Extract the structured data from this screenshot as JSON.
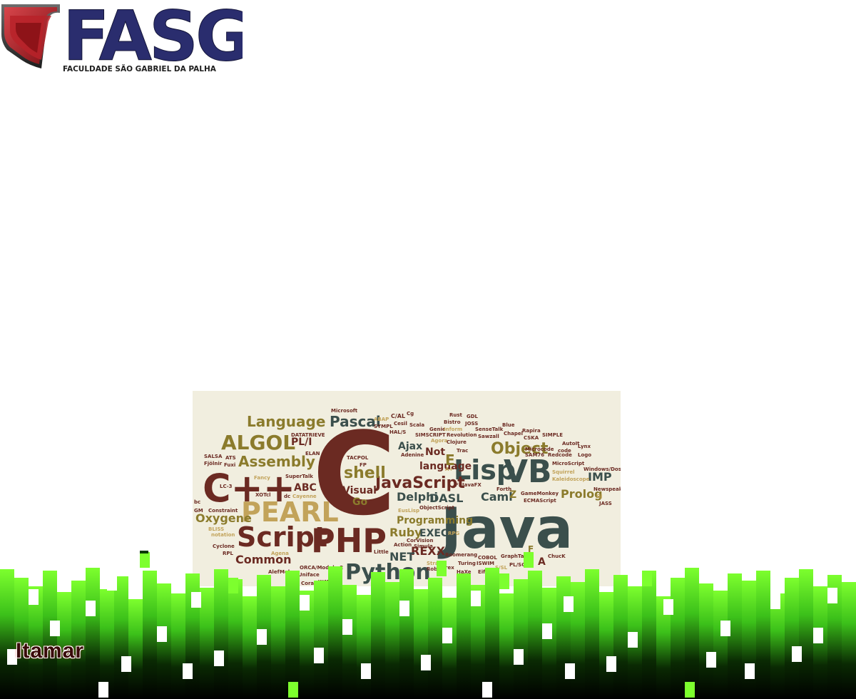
{
  "logo": {
    "name": "FASG",
    "subtitle": "FACULDADE SÃO GABRIEL DA PALHA",
    "colors": {
      "primary": "#2a2d6e",
      "accent": "#b3202a"
    }
  },
  "word_cloud": {
    "colors": [
      "#3b4f4c",
      "#6b2a22",
      "#8b7b2c",
      "#c2a35a"
    ],
    "words": [
      "Java",
      "C",
      "C++",
      "PHP",
      "Script",
      "PEARL",
      "Python",
      "ALGOL",
      "Lisp",
      "VB",
      "Language",
      "Pascal",
      "Assembly",
      "JavaScript",
      "Object",
      "shell",
      "Ruby",
      "Delphi",
      "Prolog",
      "Caml",
      "IMP",
      "Oxygene",
      "Common",
      "REXX",
      "EXEC",
      "NET",
      "Programming",
      "DASL",
      "Visual",
      "Go",
      "ABC",
      "PL/I",
      "Ajax",
      "language",
      "Not",
      "E",
      "Z",
      "A",
      "F",
      "Microsoft",
      "ABAP",
      "C/AL",
      "Cg",
      "Rust",
      "GDL",
      "Cesil",
      "Scala",
      "Bistro",
      "JOSS",
      "Blue",
      "SYMPL",
      "HAL/S",
      "Genie",
      "Inform",
      "SenseTalk",
      "Rapira",
      "DATATRIEVE",
      "SIMSCRIPT",
      "Revolution",
      "Sawzall",
      "Chapel",
      "CSKA",
      "SIMPLE",
      "ELAN",
      "Agora",
      "Clojure",
      "Microcode",
      "AutoIt",
      "Lynx",
      "Adenine",
      "Trac",
      "code",
      "SAM76",
      "Redcode",
      "Logo",
      "TACPOL",
      "SALSA",
      "ATS",
      "Fjölnir",
      "Fuxi",
      "FP",
      "A+",
      "MicroScript",
      "Windows/Dos",
      "SuperTalk",
      "Fancy",
      "Squirrel",
      "Kaleidoscope",
      "LC-3",
      "FL",
      "JavaFX",
      "Forth",
      "GameMonkey",
      "Newspeak",
      "XOTcl",
      "Cayenne",
      "ECMAScript",
      "GJ",
      "JASS",
      "bc",
      "GM",
      "Constraint",
      "ObjectScript",
      "EusLisp",
      "BLISS",
      "notation",
      "RPG",
      "Cyclone",
      "Action",
      "CorVision",
      "RPL",
      "Little",
      "Agena",
      "Boomerang",
      "COBOL",
      "GraphTalk",
      "ChucK",
      "Strand",
      "Turing",
      "Robot",
      "ISWIM",
      "PL/SQL",
      "S/SL",
      "Moby",
      "Uniface",
      "ORCA/Modula-2",
      "rex",
      "HaXe",
      "Eiffel",
      "Coral",
      "WATFOR",
      "Simula",
      "dc",
      "Alef"
    ]
  },
  "footer": {
    "author": "Itamar",
    "colors": {
      "bright": "#7dff2e",
      "mid": "#3cc11a",
      "dark": "#0a2a03",
      "black": "#000000"
    }
  }
}
